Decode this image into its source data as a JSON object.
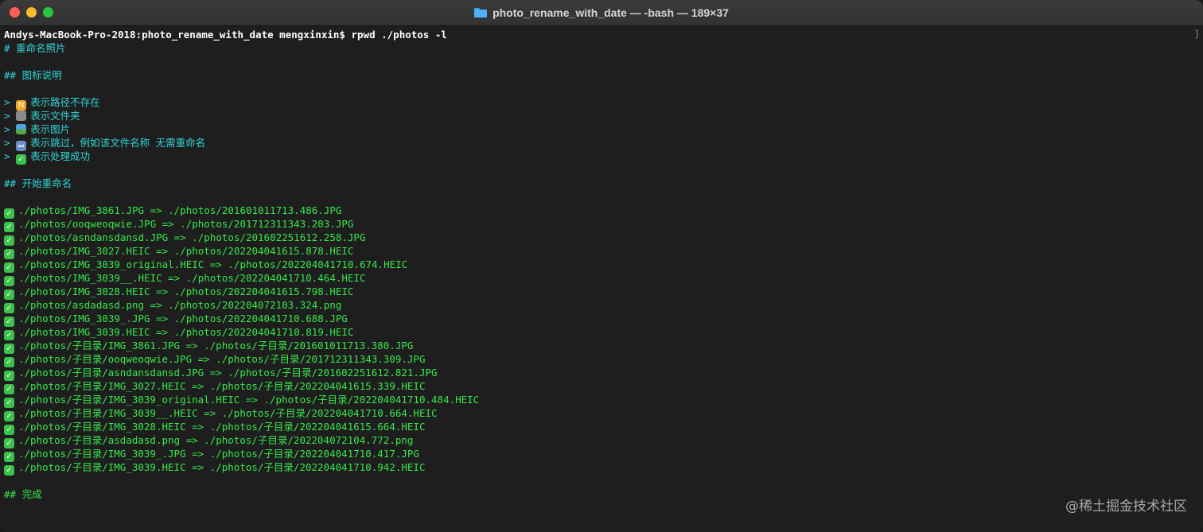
{
  "window": {
    "title": "photo_rename_with_date — -bash — 189×37"
  },
  "terminal": {
    "prompt": "Andys-MacBook-Pro-2018:photo_rename_with_date mengxinxin$ rpwd ./photos -l",
    "cursor_mark": "]",
    "heading": "# 重命名照片",
    "legend_title": "## 图标说明",
    "legend": [
      "表示路径不存在",
      "表示文件夹",
      "表示图片",
      "表示跳过，例如该文件名称 无需重命名",
      "表示处理成功"
    ],
    "start_title": "## 开始重命名",
    "renames": [
      "./photos/IMG_3861.JPG => ./photos/201601011713.486.JPG",
      "./photos/ooqweoqwie.JPG => ./photos/201712311343.203.JPG",
      "./photos/asndansdansd.JPG => ./photos/201602251612.258.JPG",
      "./photos/IMG_3027.HEIC => ./photos/202204041615.878.HEIC",
      "./photos/IMG_3039_original.HEIC => ./photos/202204041710.674.HEIC",
      "./photos/IMG_3039__.HEIC => ./photos/202204041710.464.HEIC",
      "./photos/IMG_3028.HEIC => ./photos/202204041615.798.HEIC",
      "./photos/asdadasd.png => ./photos/202204072103.324.png",
      "./photos/IMG_3039_.JPG => ./photos/202204041710.688.JPG",
      "./photos/IMG_3039.HEIC => ./photos/202204041710.819.HEIC",
      "./photos/子目录/IMG_3861.JPG => ./photos/子目录/201601011713.380.JPG",
      "./photos/子目录/ooqweoqwie.JPG => ./photos/子目录/201712311343.309.JPG",
      "./photos/子目录/asndansdansd.JPG => ./photos/子目录/201602251612.821.JPG",
      "./photos/子目录/IMG_3027.HEIC => ./photos/子目录/202204041615.339.HEIC",
      "./photos/子目录/IMG_3039_original.HEIC => ./photos/子目录/202204041710.484.HEIC",
      "./photos/子目录/IMG_3039__.HEIC => ./photos/子目录/202204041710.664.HEIC",
      "./photos/子目录/IMG_3028.HEIC => ./photos/子目录/202204041615.664.HEIC",
      "./photos/子目录/asdadasd.png => ./photos/子目录/202204072104.772.png",
      "./photos/子目录/IMG_3039_.JPG => ./photos/子目录/202204041710.417.JPG",
      "./photos/子目录/IMG_3039.HEIC => ./photos/子目录/202204041710.942.HEIC"
    ],
    "done": "## 完成"
  },
  "icons": {
    "path_missing": "new-badge-icon",
    "folder": "folder-icon",
    "image": "image-icon",
    "skip": "skip-forward-icon",
    "success": "check-mark-icon",
    "new_badge_glyph": "N",
    "skip_glyph": "⏭",
    "check_glyph": "✓"
  },
  "watermark": "@稀土掘金技术社区",
  "colors": {
    "cyan": "#33d4d6",
    "green": "#37e84a"
  }
}
